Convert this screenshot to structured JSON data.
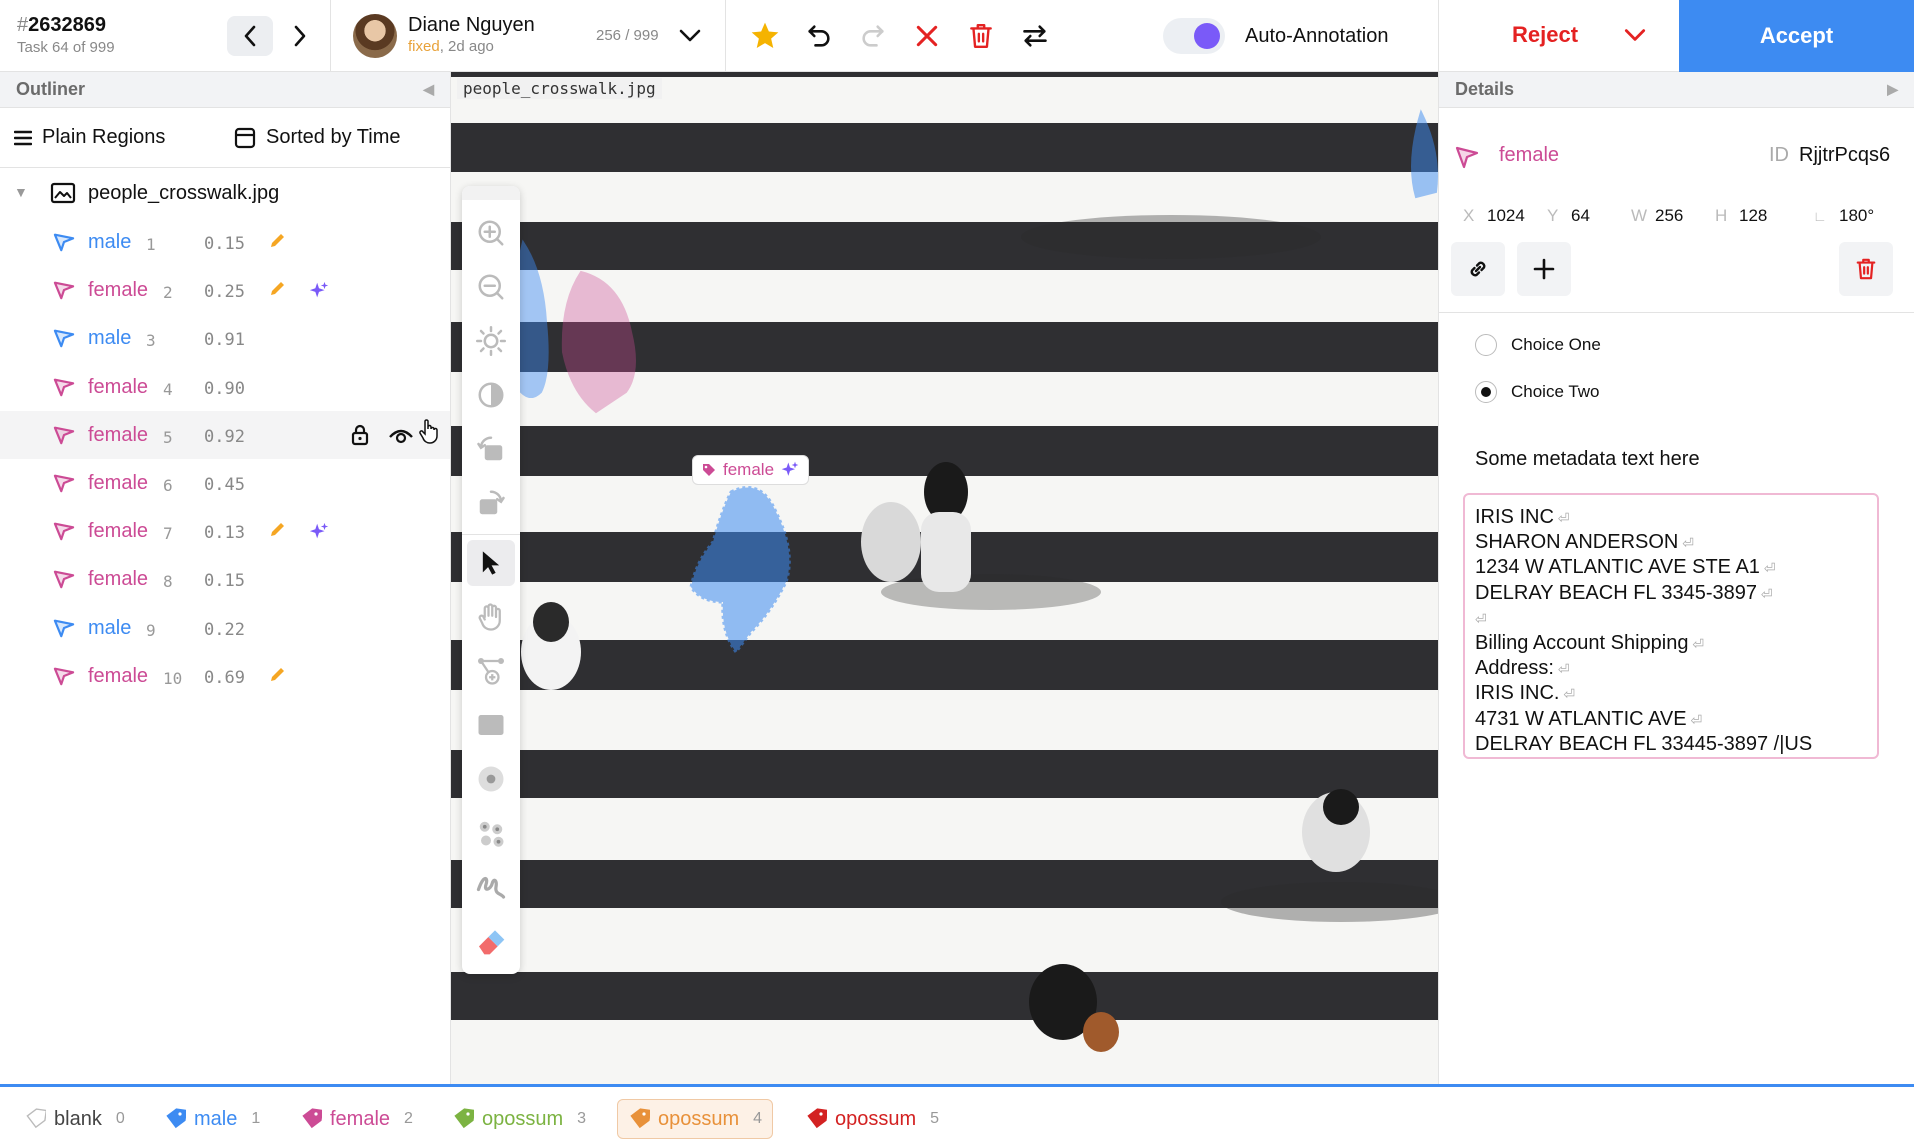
{
  "task": {
    "hash": "#",
    "id": "2632869",
    "subtitle": "Task 64 of 999"
  },
  "user": {
    "name": "Diane Nguyen",
    "status_word": "fixed",
    "status_time": ", 2d ago",
    "counter": "256 / 999"
  },
  "toolbar": {
    "auto_annotation_label": "Auto-Annotation",
    "auto_annotation_on": true,
    "reject_label": "Reject",
    "accept_label": "Accept"
  },
  "outliner": {
    "title": "Outliner",
    "group_label": "Plain Regions",
    "sort_label": "Sorted by Time",
    "file_name": "people_crosswalk.jpg",
    "regions": [
      {
        "label": "male",
        "index": "1",
        "score": "0.15",
        "edited": true,
        "auto": false
      },
      {
        "label": "female",
        "index": "2",
        "score": "0.25",
        "edited": true,
        "auto": true
      },
      {
        "label": "male",
        "index": "3",
        "score": "0.91",
        "edited": false,
        "auto": false
      },
      {
        "label": "female",
        "index": "4",
        "score": "0.90",
        "edited": false,
        "auto": false
      },
      {
        "label": "female",
        "index": "5",
        "score": "0.92",
        "edited": false,
        "auto": false,
        "hovered": true
      },
      {
        "label": "female",
        "index": "6",
        "score": "0.45",
        "edited": false,
        "auto": false
      },
      {
        "label": "female",
        "index": "7",
        "score": "0.13",
        "edited": true,
        "auto": true
      },
      {
        "label": "female",
        "index": "8",
        "score": "0.15",
        "edited": false,
        "auto": false
      },
      {
        "label": "male",
        "index": "9",
        "score": "0.22",
        "edited": false,
        "auto": false
      },
      {
        "label": "female",
        "index": "10",
        "score": "0.69",
        "edited": true,
        "auto": false
      }
    ]
  },
  "canvas": {
    "image_name": "people_crosswalk.jpg",
    "region_tag": "female"
  },
  "details": {
    "title": "Details",
    "label": "female",
    "id_key": "ID",
    "id_value": "RjjtrPcqs6",
    "x_key": "X",
    "x": "1024",
    "y_key": "Y",
    "y": "64",
    "w_key": "W",
    "w": "256",
    "h_key": "H",
    "h": "128",
    "rotation": "180°",
    "choice_one": "Choice One",
    "choice_two": "Choice Two",
    "selected_choice": "Choice Two",
    "metadata_text": "Some metadata text here",
    "textarea_lines": [
      "IRIS INC",
      "SHARON ANDERSON",
      "1234 W ATLANTIC AVE STE A1",
      "DELRAY BEACH FL 3345-3897",
      "",
      "Billing Account Shipping",
      "Address:",
      "IRIS INC.",
      "4731 W ATLANTIC AVE",
      "DELRAY BEACH FL 33445-3897 /|US"
    ]
  },
  "labels": [
    {
      "name": "blank",
      "hotkey": "0",
      "color": "#cccccc"
    },
    {
      "name": "male",
      "hotkey": "1",
      "color": "#3d8bf2"
    },
    {
      "name": "female",
      "hotkey": "2",
      "color": "#cc4b95"
    },
    {
      "name": "opossum",
      "hotkey": "3",
      "color": "#7cb342"
    },
    {
      "name": "opossum",
      "hotkey": "4",
      "color": "#e8913a",
      "selected": true
    },
    {
      "name": "opossum",
      "hotkey": "5",
      "color": "#d32222"
    }
  ],
  "colors": {
    "male": "#3d8bf2",
    "female": "#cc4b95",
    "accent": "#3d8bf2",
    "reject": "#e42222",
    "toggle": "#7a5af8",
    "star": "#f5b301"
  }
}
